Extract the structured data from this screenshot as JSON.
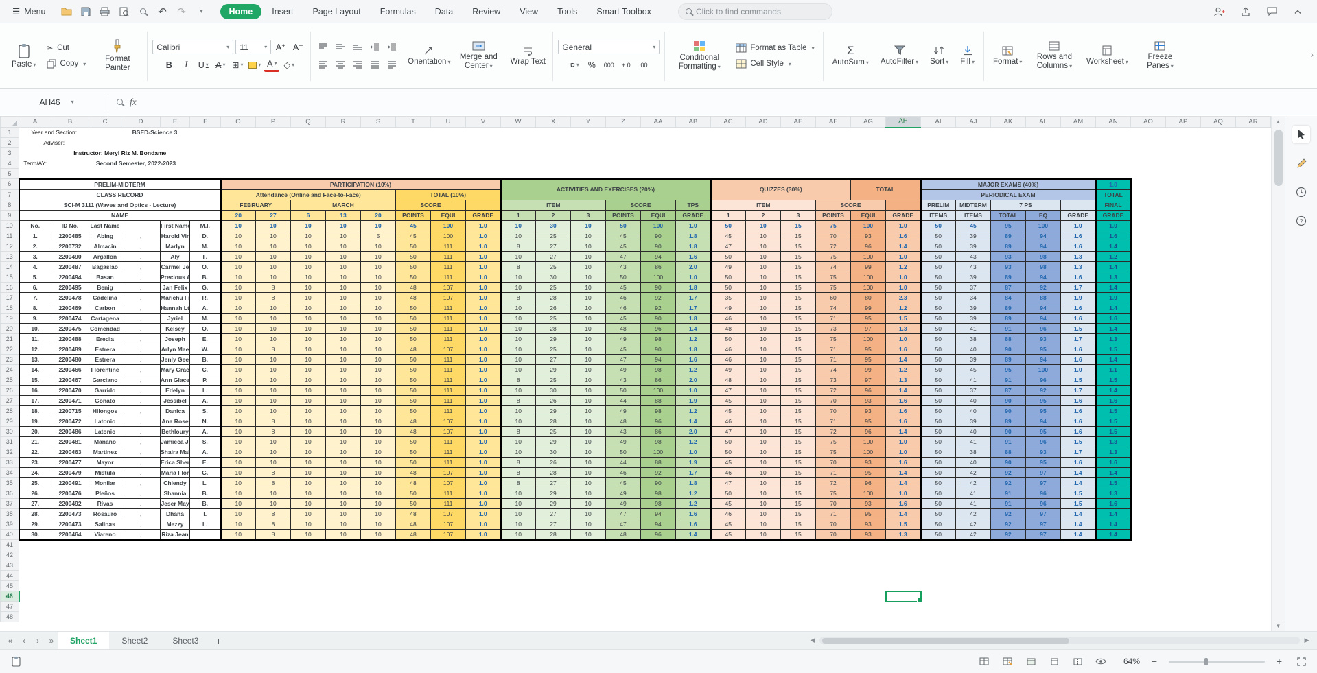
{
  "titlebar": {
    "menu": "Menu",
    "tabs": [
      "Home",
      "Insert",
      "Page Layout",
      "Formulas",
      "Data",
      "Review",
      "View",
      "Tools",
      "Smart Toolbox"
    ],
    "active_tab": "Home",
    "search_placeholder": "Click to find commands"
  },
  "ribbon": {
    "paste": "Paste",
    "cut": "Cut",
    "copy": "Copy",
    "format_painter": "Format Painter",
    "font_name": "Calibri",
    "font_size": "11",
    "orientation": "Orientation",
    "merge_center": "Merge and Center",
    "wrap_text": "Wrap Text",
    "number_format": "General",
    "comma": "000",
    "inc_decimal": "+.0",
    "dec_decimal": ".00",
    "conditional": "Conditional Formatting",
    "format_as_table": "Format as Table",
    "cell_style": "Cell Style",
    "autosum": "AutoSum",
    "autofilter": "AutoFilter",
    "sort": "Sort",
    "fill": "Fill",
    "format": "Format",
    "rows_columns": "Rows and Columns",
    "worksheet": "Worksheet",
    "freeze": "Freeze Panes"
  },
  "icons": {
    "menu": "☰",
    "caret": "▾",
    "undo": "↶",
    "redo": "↷",
    "scissors": "✂",
    "bold": "B",
    "italic": "I",
    "underline": "U",
    "strike": "A",
    "borders": "⊞",
    "eraser": "◇",
    "font_increase": "A⁺",
    "font_decrease": "A⁻",
    "currency": "¤",
    "percent": "%",
    "sigma": "Σ",
    "plus": "+",
    "minus": "−",
    "chevron_right": "›",
    "up_arrow": "▲",
    "down_arrow": "▼",
    "nav_first": "«",
    "nav_prev": "‹",
    "nav_next": "›",
    "nav_last": "»",
    "h_left": "◀",
    "h_right": "▶"
  },
  "formula_bar": {
    "name_box": "AH46",
    "fx_label": "fx"
  },
  "grid": {
    "columns": [
      "A",
      "B",
      "C",
      "D",
      "E",
      "F",
      "O",
      "P",
      "Q",
      "R",
      "S",
      "T",
      "U",
      "V",
      "W",
      "X",
      "Y",
      "Z",
      "AA",
      "AB",
      "AC",
      "AD",
      "AE",
      "AF",
      "AG",
      "AH",
      "AI",
      "AJ",
      "AK",
      "AL",
      "AM",
      "AN",
      "AO",
      "AP",
      "AQ",
      "AR"
    ],
    "row_count": 48,
    "selected_cell": "AH46",
    "selected_column": "AH",
    "selected_row": 46
  },
  "info": {
    "year_section_label": "Year and Section:",
    "year_section_value": "BSED-Science 3",
    "adviser_label": "Adviser:",
    "instructor_line": "Instructor: Meryl Riz M. Bondame",
    "term_label": "Term/AY:",
    "term_value": "Second Semester, 2022-2023"
  },
  "record": {
    "prelim_midterm": "PRELIM-MIDTERM",
    "class_record": "CLASS RECORD",
    "subject": "SCI-M 3111 (Waves and Optics - Lecture)",
    "name": "NAME",
    "no": "No.",
    "id_no": "ID No.",
    "last_name": "Last Name",
    "first_name": "First Name",
    "mi": "M.I.",
    "participation": {
      "title": "PARTICIPATION (10%)",
      "attendance": "Attendance (Online and Face-to-Face)",
      "total": "TOTAL (10%)",
      "february": "FEBRUARY",
      "march": "MARCH",
      "score": "SCORE",
      "dates": [
        "20",
        "27",
        "6",
        "13",
        "20"
      ],
      "points": "POINTS",
      "equi": "EQUI",
      "grade": "GRADE"
    },
    "activities": {
      "title": "ACTIVITIES AND EXERCISES (20%)",
      "item": "ITEM",
      "score": "SCORE",
      "tps": "TPS",
      "items": [
        "1",
        "2",
        "3"
      ],
      "points": "POINTS",
      "equi": "EQUI",
      "grade": "GRADE"
    },
    "quizzes": {
      "title": "QUIZZES (30%)",
      "total": "TOTAL",
      "item": "ITEM",
      "score": "SCORE",
      "items": [
        "1",
        "2",
        "3"
      ],
      "points": "POINTS",
      "equi": "EQUI",
      "grade": "GRADE"
    },
    "major_exams": {
      "title": "MAJOR EXAMS (40%)",
      "periodical": "PERIODICAL EXAM",
      "prelim": "PRELIM",
      "midterm": "MIDTERM",
      "tps": "7 PS",
      "items": "ITEMS",
      "total": "TOTAL",
      "eq": "EQ",
      "grade": "GRADE"
    },
    "final": {
      "top": "1.0",
      "total": "TOTAL",
      "final": "FINAL",
      "grade": "GRADE"
    },
    "hps": [
      "10",
      "10",
      "10",
      "10",
      "10",
      "45",
      "100",
      "1.0",
      "10",
      "30",
      "10",
      "50",
      "100",
      "1.0",
      "50",
      "10",
      "15",
      "75",
      "100",
      "1.0",
      "50",
      "45",
      "95",
      "100",
      "1.0",
      "1.0"
    ],
    "students": [
      [
        "1.",
        "2200485",
        "Abing",
        ",",
        "Harold Vir",
        "D.",
        "10",
        "10",
        "10",
        "10",
        "5",
        "45",
        "100",
        "1.0",
        "10",
        "25",
        "10",
        "45",
        "90",
        "1.8",
        "45",
        "10",
        "15",
        "70",
        "93",
        "1.6",
        "50",
        "39",
        "89",
        "94",
        "1.6",
        "1.6"
      ],
      [
        "2.",
        "2200732",
        "Almacin",
        ",",
        "Marlyn",
        "M.",
        "10",
        "10",
        "10",
        "10",
        "10",
        "50",
        "111",
        "1.0",
        "8",
        "27",
        "10",
        "45",
        "90",
        "1.8",
        "47",
        "10",
        "15",
        "72",
        "96",
        "1.4",
        "50",
        "39",
        "89",
        "94",
        "1.6",
        "1.4"
      ],
      [
        "3.",
        "2200490",
        "Argallon",
        ",",
        "Aly",
        "F.",
        "10",
        "10",
        "10",
        "10",
        "10",
        "50",
        "111",
        "1.0",
        "10",
        "27",
        "10",
        "47",
        "94",
        "1.6",
        "50",
        "10",
        "15",
        "75",
        "100",
        "1.0",
        "50",
        "43",
        "93",
        "98",
        "1.3",
        "1.2"
      ],
      [
        "4.",
        "2200487",
        "Bagaslao",
        ",",
        "Carmel Je",
        "O.",
        "10",
        "10",
        "10",
        "10",
        "10",
        "50",
        "111",
        "1.0",
        "8",
        "25",
        "10",
        "43",
        "86",
        "2.0",
        "49",
        "10",
        "15",
        "74",
        "99",
        "1.2",
        "50",
        "43",
        "93",
        "98",
        "1.3",
        "1.4"
      ],
      [
        "5.",
        "2200494",
        "Basan",
        ",",
        "Precious A",
        "B.",
        "10",
        "10",
        "10",
        "10",
        "10",
        "50",
        "111",
        "1.0",
        "10",
        "30",
        "10",
        "50",
        "100",
        "1.0",
        "50",
        "10",
        "15",
        "75",
        "100",
        "1.0",
        "50",
        "39",
        "89",
        "94",
        "1.6",
        "1.3"
      ],
      [
        "6.",
        "2200495",
        "Benig",
        ",",
        "Jan Felix",
        "G.",
        "10",
        "8",
        "10",
        "10",
        "10",
        "48",
        "107",
        "1.0",
        "10",
        "25",
        "10",
        "45",
        "90",
        "1.8",
        "50",
        "10",
        "15",
        "75",
        "100",
        "1.0",
        "50",
        "37",
        "87",
        "92",
        "1.7",
        "1.4"
      ],
      [
        "7.",
        "2200478",
        "Cadeliña",
        ",",
        "Marichu Fr",
        "R.",
        "10",
        "8",
        "10",
        "10",
        "10",
        "48",
        "107",
        "1.0",
        "8",
        "28",
        "10",
        "46",
        "92",
        "1.7",
        "35",
        "10",
        "15",
        "60",
        "80",
        "2.3",
        "50",
        "34",
        "84",
        "88",
        "1.9",
        "1.9"
      ],
      [
        "8.",
        "2200469",
        "Carbon",
        ",",
        "Hannah Lt",
        "A.",
        "10",
        "10",
        "10",
        "10",
        "10",
        "50",
        "111",
        "1.0",
        "10",
        "26",
        "10",
        "46",
        "92",
        "1.7",
        "49",
        "10",
        "15",
        "74",
        "99",
        "1.2",
        "50",
        "39",
        "89",
        "94",
        "1.6",
        "1.4"
      ],
      [
        "9.",
        "2200474",
        "Cartagena",
        ",",
        "Jyriel",
        "M.",
        "10",
        "10",
        "10",
        "10",
        "10",
        "50",
        "111",
        "1.0",
        "10",
        "25",
        "10",
        "45",
        "90",
        "1.8",
        "46",
        "10",
        "15",
        "71",
        "95",
        "1.5",
        "50",
        "39",
        "89",
        "94",
        "1.6",
        "1.6"
      ],
      [
        "10.",
        "2200475",
        "Comendad",
        ",",
        "Kelsey",
        "O.",
        "10",
        "10",
        "10",
        "10",
        "10",
        "50",
        "111",
        "1.0",
        "10",
        "28",
        "10",
        "48",
        "96",
        "1.4",
        "48",
        "10",
        "15",
        "73",
        "97",
        "1.3",
        "50",
        "41",
        "91",
        "96",
        "1.5",
        "1.4"
      ],
      [
        "11.",
        "2200488",
        "Eredia",
        ",",
        "Joseph",
        "E.",
        "10",
        "10",
        "10",
        "10",
        "10",
        "50",
        "111",
        "1.0",
        "10",
        "29",
        "10",
        "49",
        "98",
        "1.2",
        "50",
        "10",
        "15",
        "75",
        "100",
        "1.0",
        "50",
        "38",
        "88",
        "93",
        "1.7",
        "1.3"
      ],
      [
        "12.",
        "2200489",
        "Estrera",
        ",",
        "Arlyn Mae",
        "W.",
        "10",
        "8",
        "10",
        "10",
        "10",
        "48",
        "107",
        "1.0",
        "10",
        "25",
        "10",
        "45",
        "90",
        "1.8",
        "46",
        "10",
        "15",
        "71",
        "95",
        "1.6",
        "50",
        "40",
        "90",
        "95",
        "1.6",
        "1.5"
      ],
      [
        "13.",
        "2200480",
        "Estrera",
        ",",
        "Jenly Gee",
        "B.",
        "10",
        "10",
        "10",
        "10",
        "10",
        "50",
        "111",
        "1.0",
        "10",
        "27",
        "10",
        "47",
        "94",
        "1.6",
        "46",
        "10",
        "15",
        "71",
        "95",
        "1.4",
        "50",
        "39",
        "89",
        "94",
        "1.6",
        "1.4"
      ],
      [
        "14.",
        "2200466",
        "Florentine",
        ",",
        "Mary Grac",
        "C.",
        "10",
        "10",
        "10",
        "10",
        "10",
        "50",
        "111",
        "1.0",
        "10",
        "29",
        "10",
        "49",
        "98",
        "1.2",
        "49",
        "10",
        "15",
        "74",
        "99",
        "1.2",
        "50",
        "45",
        "95",
        "100",
        "1.0",
        "1.1"
      ],
      [
        "15.",
        "2200467",
        "Garciano",
        ",",
        "Ann Glace",
        "P.",
        "10",
        "10",
        "10",
        "10",
        "10",
        "50",
        "111",
        "1.0",
        "8",
        "25",
        "10",
        "43",
        "86",
        "2.0",
        "48",
        "10",
        "15",
        "73",
        "97",
        "1.3",
        "50",
        "41",
        "91",
        "96",
        "1.5",
        "1.5"
      ],
      [
        "16.",
        "2200470",
        "Garrido",
        ",",
        "Edelyn",
        "L.",
        "10",
        "10",
        "10",
        "10",
        "10",
        "50",
        "111",
        "1.0",
        "10",
        "30",
        "10",
        "50",
        "100",
        "1.0",
        "47",
        "10",
        "15",
        "72",
        "96",
        "1.4",
        "50",
        "37",
        "87",
        "92",
        "1.7",
        "1.4"
      ],
      [
        "17.",
        "2200471",
        "Gonato",
        ",",
        "Jessibel",
        "A.",
        "10",
        "10",
        "10",
        "10",
        "10",
        "50",
        "111",
        "1.0",
        "8",
        "26",
        "10",
        "44",
        "88",
        "1.9",
        "45",
        "10",
        "15",
        "70",
        "93",
        "1.6",
        "50",
        "40",
        "90",
        "95",
        "1.6",
        "1.6"
      ],
      [
        "18.",
        "2200715",
        "Hilongos",
        ",",
        "Danica",
        "S.",
        "10",
        "10",
        "10",
        "10",
        "10",
        "50",
        "111",
        "1.0",
        "10",
        "29",
        "10",
        "49",
        "98",
        "1.2",
        "45",
        "10",
        "15",
        "70",
        "93",
        "1.6",
        "50",
        "40",
        "90",
        "95",
        "1.6",
        "1.5"
      ],
      [
        "19.",
        "2200472",
        "Latonio",
        ",",
        "Ana Rose",
        "N.",
        "10",
        "8",
        "10",
        "10",
        "10",
        "48",
        "107",
        "1.0",
        "10",
        "28",
        "10",
        "48",
        "96",
        "1.4",
        "46",
        "10",
        "15",
        "71",
        "95",
        "1.6",
        "50",
        "39",
        "89",
        "94",
        "1.6",
        "1.5"
      ],
      [
        "20.",
        "2200486",
        "Latonio",
        ",",
        "Bethloury",
        "A.",
        "10",
        "8",
        "10",
        "10",
        "10",
        "48",
        "107",
        "1.0",
        "8",
        "25",
        "10",
        "43",
        "86",
        "2.0",
        "47",
        "10",
        "15",
        "72",
        "96",
        "1.4",
        "50",
        "40",
        "90",
        "95",
        "1.6",
        "1.5"
      ],
      [
        "21.",
        "2200481",
        "Manano",
        ",",
        "Jamieca Js",
        "S.",
        "10",
        "10",
        "10",
        "10",
        "10",
        "50",
        "111",
        "1.0",
        "10",
        "29",
        "10",
        "49",
        "98",
        "1.2",
        "50",
        "10",
        "15",
        "75",
        "100",
        "1.0",
        "50",
        "41",
        "91",
        "96",
        "1.5",
        "1.3"
      ],
      [
        "22.",
        "2200463",
        "Martinez",
        ",",
        "Shaira Mai",
        "A.",
        "10",
        "10",
        "10",
        "10",
        "10",
        "50",
        "111",
        "1.0",
        "10",
        "30",
        "10",
        "50",
        "100",
        "1.0",
        "50",
        "10",
        "15",
        "75",
        "100",
        "1.0",
        "50",
        "38",
        "88",
        "93",
        "1.7",
        "1.3"
      ],
      [
        "23.",
        "2200477",
        "Mayor",
        ",",
        "Erica Shen",
        "E.",
        "10",
        "10",
        "10",
        "10",
        "10",
        "50",
        "111",
        "1.0",
        "8",
        "26",
        "10",
        "44",
        "88",
        "1.9",
        "45",
        "10",
        "15",
        "70",
        "93",
        "1.6",
        "50",
        "40",
        "90",
        "95",
        "1.6",
        "1.6"
      ],
      [
        "24.",
        "2200479",
        "Mistula",
        ",",
        "Maria Flor",
        "G.",
        "10",
        "8",
        "10",
        "10",
        "10",
        "48",
        "107",
        "1.0",
        "8",
        "28",
        "10",
        "46",
        "92",
        "1.7",
        "46",
        "10",
        "15",
        "71",
        "95",
        "1.4",
        "50",
        "42",
        "92",
        "97",
        "1.4",
        "1.4"
      ],
      [
        "25.",
        "2200491",
        "Monilar",
        ",",
        "Chiendy",
        "L.",
        "10",
        "8",
        "10",
        "10",
        "10",
        "48",
        "107",
        "1.0",
        "8",
        "27",
        "10",
        "45",
        "90",
        "1.8",
        "47",
        "10",
        "15",
        "72",
        "96",
        "1.4",
        "50",
        "42",
        "92",
        "97",
        "1.4",
        "1.5"
      ],
      [
        "26.",
        "2200476",
        "Pleños",
        ",",
        "Shannia",
        "B.",
        "10",
        "10",
        "10",
        "10",
        "10",
        "50",
        "111",
        "1.0",
        "10",
        "29",
        "10",
        "49",
        "98",
        "1.2",
        "50",
        "10",
        "15",
        "75",
        "100",
        "1.0",
        "50",
        "41",
        "91",
        "96",
        "1.5",
        "1.3"
      ],
      [
        "27.",
        "2200492",
        "Rivas",
        ",",
        "Jeser May",
        "B.",
        "10",
        "10",
        "10",
        "10",
        "10",
        "50",
        "111",
        "1.0",
        "10",
        "29",
        "10",
        "49",
        "98",
        "1.2",
        "45",
        "10",
        "15",
        "70",
        "93",
        "1.6",
        "50",
        "41",
        "91",
        "96",
        "1.5",
        "1.6"
      ],
      [
        "28.",
        "2200473",
        "Rosauro",
        ",",
        "Dhana",
        "I.",
        "10",
        "8",
        "10",
        "10",
        "10",
        "48",
        "107",
        "1.0",
        "10",
        "27",
        "10",
        "47",
        "94",
        "1.6",
        "46",
        "10",
        "15",
        "71",
        "95",
        "1.4",
        "50",
        "42",
        "92",
        "97",
        "1.4",
        "1.4"
      ],
      [
        "29.",
        "2200473",
        "Salinas",
        ",",
        "Mezzy",
        "L.",
        "10",
        "8",
        "10",
        "10",
        "10",
        "48",
        "107",
        "1.0",
        "10",
        "27",
        "10",
        "47",
        "94",
        "1.6",
        "45",
        "10",
        "15",
        "70",
        "93",
        "1.5",
        "50",
        "42",
        "92",
        "97",
        "1.4",
        "1.4"
      ],
      [
        "30.",
        "2200464",
        "Viareno",
        ",",
        "Riza Jean",
        "",
        "10",
        "8",
        "10",
        "10",
        "10",
        "48",
        "107",
        "1.0",
        "10",
        "28",
        "10",
        "48",
        "96",
        "1.4",
        "45",
        "10",
        "15",
        "70",
        "93",
        "1.3",
        "50",
        "42",
        "92",
        "97",
        "1.4",
        "1.4"
      ]
    ]
  },
  "sheet_tabs": {
    "tabs": [
      "Sheet1",
      "Sheet2",
      "Sheet3"
    ],
    "active": "Sheet1"
  },
  "status_bar": {
    "zoom": "64%"
  }
}
